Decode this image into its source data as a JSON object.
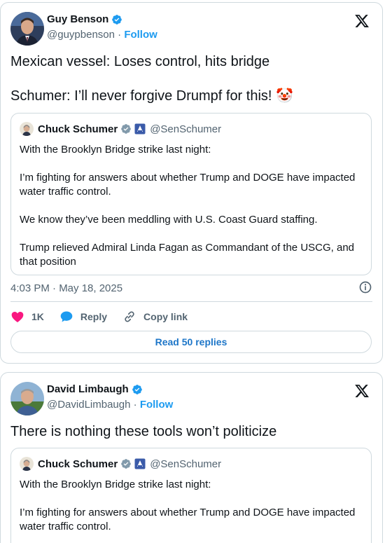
{
  "tweets": [
    {
      "author": {
        "name": "Guy Benson",
        "handle": "@guypbenson",
        "follow": "Follow"
      },
      "text_line1": "Mexican vessel: Loses control, hits bridge",
      "text_line2": "Schumer: I’ll never forgive Drumpf for this! 🤡",
      "quote": {
        "name": "Chuck Schumer",
        "handle": "@SenSchumer",
        "paragraphs": [
          "With the Brooklyn Bridge strike last night:",
          "I’m fighting for answers about whether Trump and DOGE have impacted water traffic control.",
          "We know they’ve been meddling with U.S. Coast Guard staffing.",
          "Trump relieved Admiral Linda Fagan as Commandant of the USCG, and that position"
        ]
      },
      "timestamp": "4:03 PM · May 18, 2025",
      "actions": {
        "likes": "1K",
        "reply": "Reply",
        "copy_link": "Copy link"
      },
      "read_replies": "Read 50 replies"
    },
    {
      "author": {
        "name": "David Limbaugh",
        "handle": "@DavidLimbaugh",
        "follow": "Follow"
      },
      "text_line1": "There is nothing these tools won’t politicize",
      "quote": {
        "name": "Chuck Schumer",
        "handle": "@SenSchumer",
        "paragraphs": [
          "With the Brooklyn Bridge strike last night:",
          "I’m fighting for answers about whether Trump and DOGE have impacted water traffic control."
        ]
      }
    }
  ],
  "colors": {
    "accent": "#1d9bf0",
    "like": "#f91880",
    "border": "#cfd9de",
    "secondary_text": "#536471"
  }
}
